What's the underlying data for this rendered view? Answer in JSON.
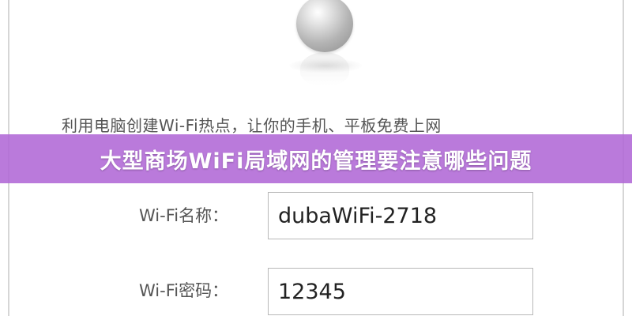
{
  "description": "利用电脑创建Wi-Fi热点，让你的手机、平板免费上网",
  "banner": {
    "title": "大型商场WiFi局域网的管理要注意哪些问题"
  },
  "form": {
    "name_label": "Wi-Fi名称：",
    "name_value": "dubaWiFi-2718",
    "password_label": "Wi-Fi密码：",
    "password_value": "12345"
  },
  "colors": {
    "banner_bg": "#b068d6",
    "banner_text": "#ffffff",
    "label_text": "#555555"
  }
}
